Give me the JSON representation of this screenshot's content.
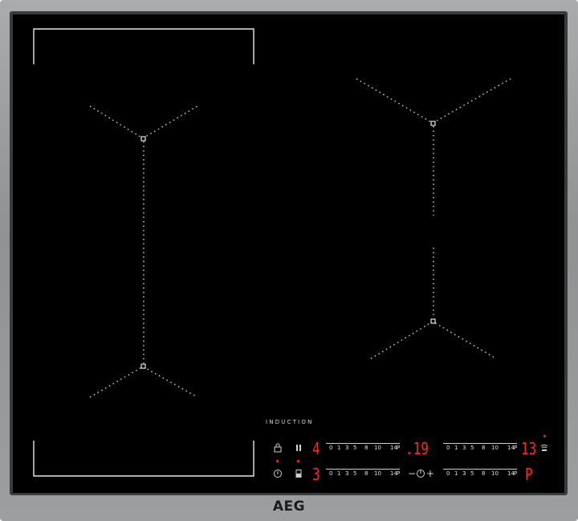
{
  "brand": "AEG",
  "panel_label": "INDUCTION",
  "colors": {
    "glass": "#000000",
    "frame": "#9a9c9e",
    "display_red": "#ff2a1f",
    "print": "#cfcfcf"
  },
  "icons": {
    "lock": "lock-icon",
    "pause": "pause-icon",
    "power": "power-icon",
    "bridge": "bridge-icon",
    "hob2hood": "hob2hood-icon",
    "timer": "timer-icon"
  },
  "zones": {
    "left_display": "4",
    "left_bottom_display": "3",
    "right_top_display": "13",
    "right_bottom_display": "P",
    "timer_display": ".19"
  },
  "scale": {
    "labels": [
      "0",
      "1",
      "3",
      "5",
      "8",
      "10",
      "14",
      "P"
    ]
  },
  "timer": {
    "minus": "−",
    "plus": "+"
  }
}
